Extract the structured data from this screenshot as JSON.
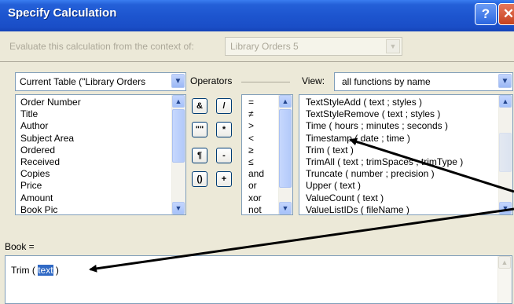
{
  "window": {
    "title": "Specify Calculation",
    "help_glyph": "?",
    "close_glyph": "✕"
  },
  "context": {
    "label": "Evaluate this calculation from the context of:",
    "selected": "Library Orders 5"
  },
  "fields": {
    "table_select": "Current Table (\"Library Orders",
    "items": [
      "Order Number",
      "Title",
      "Author",
      "Subject Area",
      "Ordered",
      "Received",
      "Copies",
      "Price",
      "Amount",
      "Book Pic"
    ]
  },
  "operators": {
    "label": "Operators",
    "buttons": [
      "&",
      "/",
      "\"\"",
      "*",
      "¶",
      "-",
      "()",
      "+"
    ],
    "list": [
      "=",
      "≠",
      ">",
      "<",
      "≥",
      "≤",
      "and",
      "or",
      "xor",
      "not"
    ]
  },
  "functions": {
    "view_label": "View:",
    "view_selected": "all functions by name",
    "items": [
      "TextStyleAdd ( text ; styles )",
      "TextStyleRemove ( text ; styles )",
      "Time ( hours ; minutes ; seconds )",
      "Timestamp ( date ; time )",
      "Trim ( text )",
      "TrimAll ( text ; trimSpaces ; trimType )",
      "Truncate ( number ; precision )",
      "Upper ( text )",
      "ValueCount ( text )",
      "ValueListIDs ( fileName )"
    ]
  },
  "formula": {
    "label": "Book =",
    "prefix": "Trim ( ",
    "selected": "text",
    "suffix": " )"
  }
}
